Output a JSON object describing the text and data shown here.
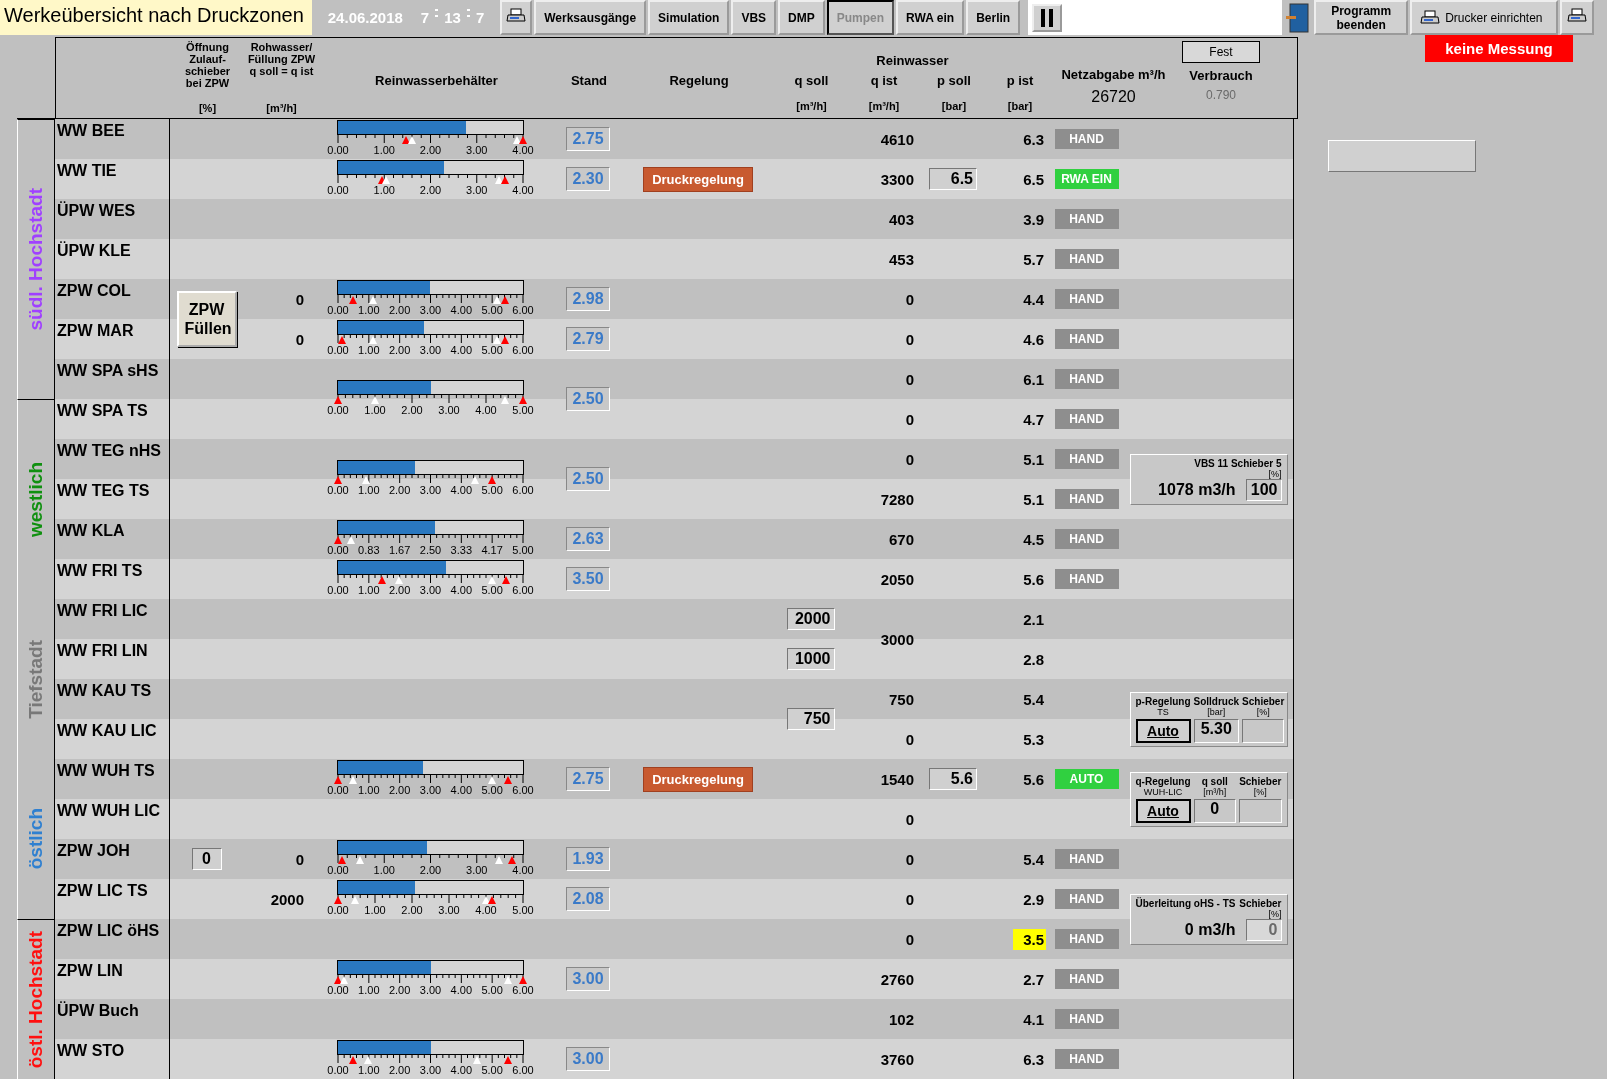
{
  "title": "Werkeübersicht nach Druckzonen",
  "date": "24.06.2018",
  "time": {
    "hours": "7",
    "minutes": "13",
    "seconds": "7"
  },
  "toolbar": [
    {
      "label": "Werksausgänge",
      "selected": false
    },
    {
      "label": "Simulation",
      "selected": false
    },
    {
      "label": "VBS",
      "selected": false
    },
    {
      "label": "DMP",
      "selected": false
    },
    {
      "label": "Pumpen",
      "selected": true
    },
    {
      "label": "RWA ein",
      "selected": false
    },
    {
      "label": "Berlin",
      "selected": false
    }
  ],
  "exit_button": "Programm beenden",
  "printer_setup_button": "Drucker einrichten",
  "status_badge": "keine Messung",
  "header": {
    "opening": {
      "label": "Öffnung Zulauf-schieber bei ZPW",
      "unit": "[%]"
    },
    "raw": {
      "label": "Rohwasser/ Füllung ZPW q soll = q ist",
      "unit": "[m³/h]"
    },
    "tank": "Reinwasserbehälter",
    "stand": "Stand",
    "control": "Regelung",
    "group": "Reinwasser",
    "q_soll": {
      "label": "q soll",
      "unit": "[m³/h]"
    },
    "q_ist": {
      "label": "q ist",
      "unit": "[m³/h]"
    },
    "p_soll": {
      "label": "p soll",
      "unit": "[bar]"
    },
    "p_ist": {
      "label": "p ist",
      "unit": "[bar]"
    },
    "net": {
      "label": "Netzabgabe m³/h",
      "value": "26720"
    },
    "consumption": {
      "label": "Verbrauch",
      "value": "0.790",
      "button": "Fest"
    }
  },
  "zones": [
    {
      "label": "südl. Hochstadt",
      "color": "#a040ff",
      "new_section": true,
      "rows": [
        {
          "name": "WW BEE",
          "tank": {
            "level": 0.69,
            "stand": "2.75",
            "ticks": [
              "0.00",
              "1.00",
              "2.00",
              "3.00",
              "4.00"
            ],
            "markers": [
              {
                "kind": "alarm",
                "level": 0.37
              },
              {
                "kind": "switch",
                "level": 0.4
              },
              {
                "kind": "switch",
                "level": 0.97
              },
              {
                "kind": "alarm",
                "level": 1
              }
            ]
          },
          "q_ist": "4610",
          "p_ist": "6.3",
          "p_alarm": false,
          "mode": {
            "kind": "hand",
            "label": "HAND"
          }
        },
        {
          "name": "WW TIE",
          "tank": {
            "level": 0.575,
            "stand": "2.30",
            "ticks": [
              "0.00",
              "1.00",
              "2.00",
              "3.00",
              "4.00"
            ],
            "markers": [
              {
                "kind": "alarm",
                "level": 0.24
              },
              {
                "kind": "switch",
                "level": 0.26
              },
              {
                "kind": "switch",
                "level": 0.87
              },
              {
                "kind": "alarm",
                "level": 0.9
              }
            ]
          },
          "control": "Druckregelung",
          "q_ist": "3300",
          "p_soll": "6.5",
          "p_ist": "6.5",
          "p_alarm": false,
          "mode": {
            "kind": "rwa",
            "label": "RWA EIN"
          }
        },
        {
          "name": "ÜPW WES",
          "q_ist": "403",
          "p_ist": "3.9",
          "p_alarm": false,
          "mode": {
            "kind": "hand",
            "label": "HAND"
          }
        },
        {
          "name": "ÜPW KLE",
          "q_ist": "453",
          "p_ist": "5.7",
          "p_alarm": false,
          "mode": {
            "kind": "hand",
            "label": "HAND"
          }
        },
        {
          "name": "ZPW COL",
          "fill_button_shared": "ZPW Füllen",
          "raw": "0",
          "tank": {
            "level": 0.497,
            "stand": "2.98",
            "ticks": [
              "0.00",
              "1.00",
              "2.00",
              "3.00",
              "4.00",
              "5.00",
              "6.00"
            ],
            "markers": [
              {
                "kind": "alarm",
                "level": 0.08
              },
              {
                "kind": "switch",
                "level": 0.19
              },
              {
                "kind": "switch",
                "level": 0.86
              },
              {
                "kind": "alarm",
                "level": 0.9
              }
            ]
          },
          "q_ist": "0",
          "p_ist": "4.4",
          "p_alarm": false,
          "mode": {
            "kind": "hand",
            "label": "HAND"
          }
        },
        {
          "name": "ZPW MAR",
          "raw": "0",
          "tank": {
            "level": 0.465,
            "stand": "2.79",
            "ticks": [
              "0.00",
              "1.00",
              "2.00",
              "3.00",
              "4.00",
              "5.00",
              "6.00"
            ],
            "markers": [
              {
                "kind": "alarm",
                "level": 0.02
              },
              {
                "kind": "switch",
                "level": 0.19
              },
              {
                "kind": "switch",
                "level": 0.86
              },
              {
                "kind": "alarm",
                "level": 0.9
              }
            ]
          },
          "q_ist": "0",
          "p_ist": "4.6",
          "p_alarm": false,
          "mode": {
            "kind": "hand",
            "label": "HAND"
          }
        },
        {
          "name": "WW SPA sHS",
          "tank_shared": {
            "level": 0.5,
            "stand": "2.50",
            "ticks": [
              "0.00",
              "1.00",
              "2.00",
              "3.00",
              "4.00",
              "5.00"
            ],
            "markers": [
              {
                "kind": "alarm",
                "level": 0
              },
              {
                "kind": "switch",
                "level": 0.2
              },
              {
                "kind": "switch",
                "level": 0.9
              },
              {
                "kind": "alarm",
                "level": 1
              }
            ]
          },
          "q_ist": "0",
          "p_ist": "6.1",
          "p_alarm": false,
          "mode": {
            "kind": "hand",
            "label": "HAND"
          }
        }
      ]
    },
    {
      "label": "westlich",
      "color": "#109010",
      "new_section": true,
      "rows": [
        {
          "name": "WW SPA TS",
          "q_ist": "0",
          "p_ist": "4.7",
          "p_alarm": false,
          "mode": {
            "kind": "hand",
            "label": "HAND"
          }
        },
        {
          "name": "WW TEG nHS",
          "tank_shared": {
            "level": 0.417,
            "stand": "2.50",
            "ticks": [
              "0.00",
              "1.00",
              "2.00",
              "3.00",
              "4.00",
              "5.00",
              "6.00"
            ],
            "markers": [
              {
                "kind": "alarm",
                "level": 0
              },
              {
                "kind": "switch",
                "level": 0.15
              },
              {
                "kind": "switch",
                "level": 0.74
              },
              {
                "kind": "alarm",
                "level": 0.83
              }
            ]
          },
          "q_ist": "0",
          "p_ist": "5.1",
          "p_alarm": false,
          "mode": {
            "kind": "hand",
            "label": "HAND"
          },
          "panel": {
            "kind": "flow",
            "title": "VBS 11 Schieber 5",
            "unit": "[%]",
            "flow": "1078 m3/h",
            "value": "100",
            "disabled": false
          }
        },
        {
          "name": "WW TEG TS",
          "q_ist": "7280",
          "p_ist": "5.1",
          "p_alarm": false,
          "mode": {
            "kind": "hand",
            "label": "HAND"
          }
        },
        {
          "name": "WW KLA",
          "tank": {
            "level": 0.526,
            "stand": "2.63",
            "ticks": [
              "0.00",
              "0.83",
              "1.67",
              "2.50",
              "3.33",
              "4.17",
              "5.00"
            ],
            "markers": [
              {
                "kind": "alarm",
                "level": 0
              },
              {
                "kind": "switch",
                "level": 0.07
              }
            ]
          },
          "q_ist": "670",
          "p_ist": "4.5",
          "p_alarm": false,
          "mode": {
            "kind": "hand",
            "label": "HAND"
          }
        },
        {
          "name": "WW FRI TS",
          "tank": {
            "level": 0.583,
            "stand": "3.50",
            "ticks": [
              "0.00",
              "1.00",
              "2.00",
              "3.00",
              "4.00",
              "5.00",
              "6.00"
            ],
            "markers": [
              {
                "kind": "alarm",
                "level": 0.24
              },
              {
                "kind": "switch",
                "level": 0.33
              },
              {
                "kind": "switch",
                "level": 0.83
              },
              {
                "kind": "alarm",
                "level": 0.91
              }
            ]
          },
          "q_ist": "2050",
          "p_ist": "5.6",
          "p_alarm": false,
          "mode": {
            "kind": "hand",
            "label": "HAND"
          }
        }
      ]
    },
    {
      "label": "Tiefstadt",
      "color": "#787878",
      "new_section": false,
      "rows": [
        {
          "name": "WW FRI LIC",
          "q_soll": "2000",
          "q_ist_shared": "3000",
          "p_ist": "2.1",
          "p_alarm": false
        },
        {
          "name": "WW FRI LIN",
          "q_soll": "1000",
          "p_ist": "2.8",
          "p_alarm": false
        },
        {
          "name": "WW KAU TS",
          "q_soll_shared": "750",
          "q_ist": "750",
          "p_ist": "5.4",
          "p_alarm": false,
          "panel": {
            "kind": "control",
            "columns": [
              {
                "label": "p-Regelung",
                "unit": "TS"
              },
              {
                "label": "Solldruck",
                "unit": "[bar]"
              },
              {
                "label": "Schieber",
                "unit": "[%]"
              }
            ],
            "button": "Auto",
            "value": "5.30"
          }
        },
        {
          "name": "WW KAU LIC",
          "q_ist": "0",
          "p_ist": "5.3",
          "p_alarm": false
        }
      ]
    },
    {
      "label": "östlich",
      "color": "#3080d0",
      "new_section": false,
      "rows": [
        {
          "name": "WW WUH TS",
          "tank": {
            "level": 0.458,
            "stand": "2.75",
            "ticks": [
              "0.00",
              "1.00",
              "2.00",
              "3.00",
              "4.00",
              "5.00",
              "6.00"
            ],
            "markers": [
              {
                "kind": "alarm",
                "level": 0
              },
              {
                "kind": "switch",
                "level": 0.08
              },
              {
                "kind": "switch",
                "level": 0.83
              },
              {
                "kind": "alarm",
                "level": 0.92
              }
            ]
          },
          "control": "Druckregelung",
          "q_ist": "1540",
          "p_soll": "5.6",
          "p_ist": "5.6",
          "p_alarm": false,
          "mode": {
            "kind": "auto",
            "label": "AUTO"
          },
          "panel": {
            "kind": "control",
            "columns": [
              {
                "label": "q-Regelung",
                "unit": "WUH-LIC"
              },
              {
                "label": "q soll",
                "unit": "[m³/h]"
              },
              {
                "label": "Schieber",
                "unit": "[%]"
              }
            ],
            "button": "Auto",
            "value": "0"
          }
        },
        {
          "name": "WW WUH LIC",
          "q_ist": "0"
        },
        {
          "name": "ZPW JOH",
          "opening": "0",
          "raw": "0",
          "tank": {
            "level": 0.483,
            "stand": "1.93",
            "ticks": [
              "0.00",
              "1.00",
              "2.00",
              "3.00",
              "4.00"
            ],
            "markers": [
              {
                "kind": "alarm",
                "level": 0.02
              },
              {
                "kind": "switch",
                "level": 0.12
              },
              {
                "kind": "switch",
                "level": 0.87
              },
              {
                "kind": "alarm",
                "level": 0.94
              }
            ]
          },
          "q_ist": "0",
          "p_ist": "5.4",
          "p_alarm": false,
          "mode": {
            "kind": "hand",
            "label": "HAND"
          }
        },
        {
          "name": "ZPW LIC TS",
          "raw": "2000",
          "tank": {
            "level": 0.416,
            "stand": "2.08",
            "ticks": [
              "0.00",
              "1.00",
              "2.00",
              "3.00",
              "4.00",
              "5.00"
            ],
            "markers": [
              {
                "kind": "alarm",
                "level": 0
              },
              {
                "kind": "switch",
                "level": 0.09
              },
              {
                "kind": "switch",
                "level": 0.8
              },
              {
                "kind": "alarm",
                "level": 0.83
              }
            ]
          },
          "q_ist": "0",
          "p_ist": "2.9",
          "p_alarm": false,
          "mode": {
            "kind": "hand",
            "label": "HAND"
          },
          "panel": {
            "kind": "flow",
            "title": "Überleitung oHS - TS",
            "heading": "Schieber",
            "unit": "[%]",
            "flow": "0 m3/h",
            "value": "0",
            "disabled": true
          }
        }
      ]
    },
    {
      "label": "östl. Hochstadt",
      "color": "#ff1010",
      "new_section": true,
      "rows": [
        {
          "name": "ZPW LIC öHS",
          "q_ist": "0",
          "p_ist": "3.5",
          "p_alarm": true,
          "mode": {
            "kind": "hand",
            "label": "HAND"
          }
        },
        {
          "name": "ZPW LIN",
          "tank": {
            "level": 0.5,
            "stand": "3.00",
            "ticks": [
              "0.00",
              "1.00",
              "2.00",
              "3.00",
              "4.00",
              "5.00",
              "6.00"
            ],
            "markers": [
              {
                "kind": "alarm",
                "level": 0
              },
              {
                "kind": "switch",
                "level": 0.03
              },
              {
                "kind": "switch",
                "level": 0.92
              },
              {
                "kind": "alarm",
                "level": 1
              }
            ]
          },
          "q_ist": "2760",
          "p_ist": "2.7",
          "p_alarm": false,
          "mode": {
            "kind": "hand",
            "label": "HAND"
          }
        },
        {
          "name": "ÜPW Buch",
          "q_ist": "102",
          "p_ist": "4.1",
          "p_alarm": false,
          "mode": {
            "kind": "hand",
            "label": "HAND"
          }
        },
        {
          "name": "WW STO",
          "tank": {
            "level": 0.5,
            "stand": "3.00",
            "ticks": [
              "0.00",
              "1.00",
              "2.00",
              "3.00",
              "4.00",
              "5.00",
              "6.00"
            ],
            "markers": [
              {
                "kind": "alarm",
                "level": 0.08
              },
              {
                "kind": "switch",
                "level": 0.16
              },
              {
                "kind": "switch",
                "level": 0.75
              },
              {
                "kind": "alarm",
                "level": 0.92
              }
            ]
          },
          "q_ist": "3760",
          "p_ist": "6.3",
          "p_alarm": false,
          "mode": {
            "kind": "hand",
            "label": "HAND"
          }
        }
      ]
    }
  ]
}
